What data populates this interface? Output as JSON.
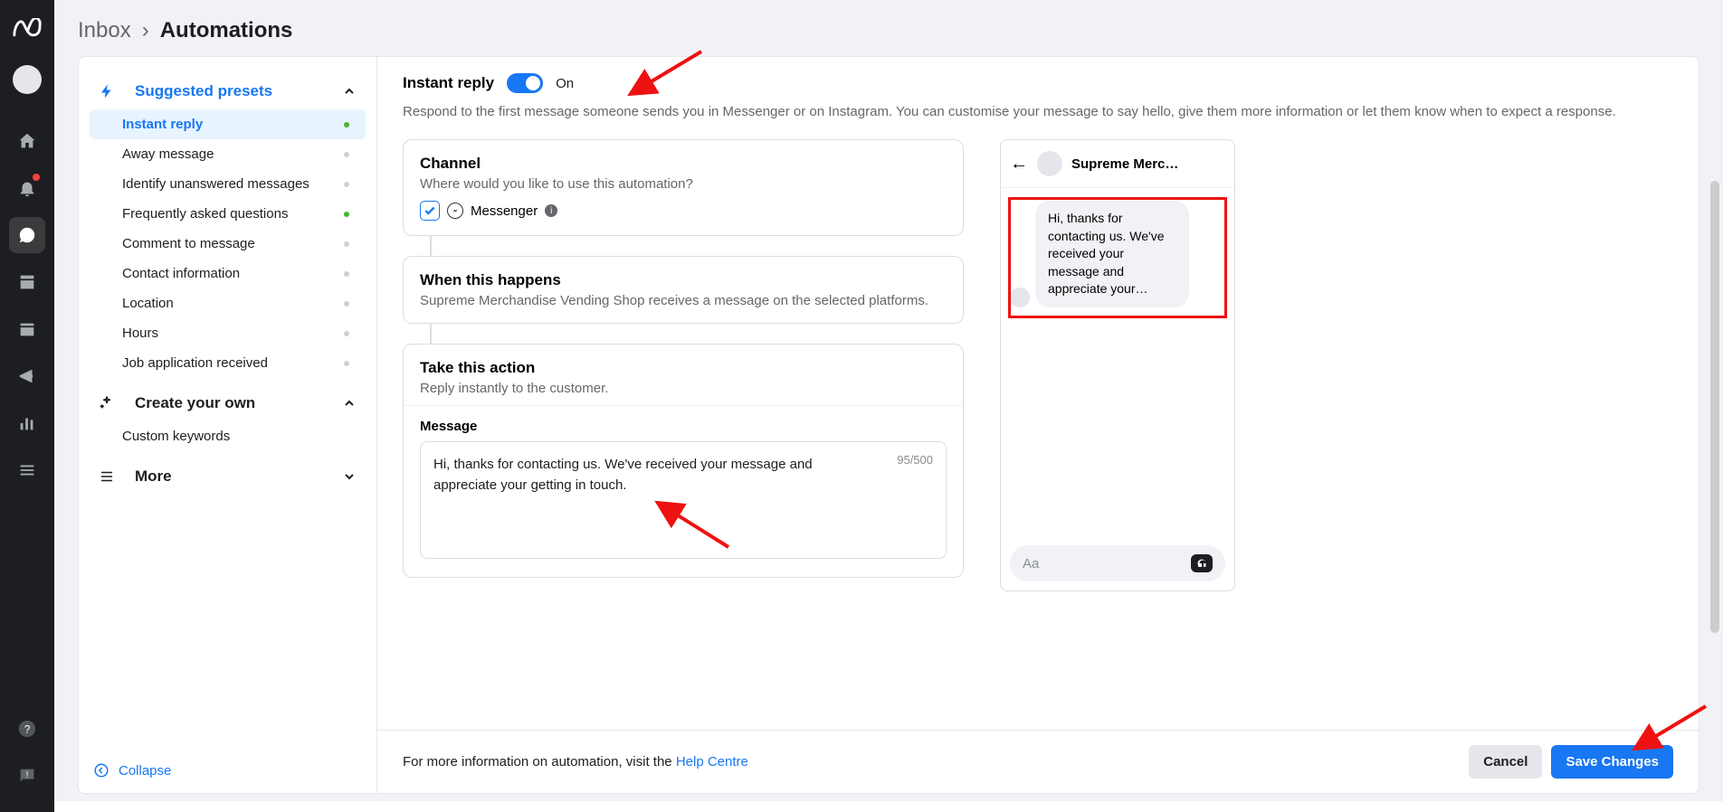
{
  "breadcrumb": {
    "part1": "Inbox",
    "part2": "Automations"
  },
  "sidebar": {
    "suggested_label": "Suggested presets",
    "create_label": "Create your own",
    "more_label": "More",
    "collapse_label": "Collapse",
    "items": [
      {
        "label": "Instant reply",
        "active": true,
        "dot": "green"
      },
      {
        "label": "Away message",
        "dot": "none"
      },
      {
        "label": "Identify unanswered messages",
        "dot": "none"
      },
      {
        "label": "Frequently asked questions",
        "dot": "green"
      },
      {
        "label": "Comment to message",
        "dot": "none"
      },
      {
        "label": "Contact information",
        "dot": "none"
      },
      {
        "label": "Location",
        "dot": "none"
      },
      {
        "label": "Hours",
        "dot": "none"
      },
      {
        "label": "Job application received",
        "dot": "none"
      }
    ],
    "custom_keywords": "Custom keywords"
  },
  "header": {
    "title": "Instant reply",
    "toggle_state": "On",
    "description": "Respond to the first message someone sends you in Messenger or on Instagram. You can customise your message to say hello, give them more information or let them know when to expect a response."
  },
  "flow": {
    "channel": {
      "title": "Channel",
      "sub": "Where would you like to use this automation?",
      "messenger": "Messenger"
    },
    "when": {
      "title": "When this happens",
      "sub": "Supreme Merchandise Vending Shop receives a message on the selected platforms."
    },
    "action": {
      "title": "Take this action",
      "sub": "Reply instantly to the customer.",
      "msg_label": "Message",
      "msg_text": "Hi, thanks for contacting us. We've received your message and appreciate your getting in touch.",
      "msg_count": "95/500"
    }
  },
  "preview": {
    "name": "Supreme Merc…",
    "bubble": "Hi, thanks for contacting us. We've received your message and appreciate your…",
    "placeholder": "Aa"
  },
  "footer": {
    "text": "For more information on automation, visit the ",
    "link": "Help Centre",
    "cancel": "Cancel",
    "save": "Save Changes"
  }
}
